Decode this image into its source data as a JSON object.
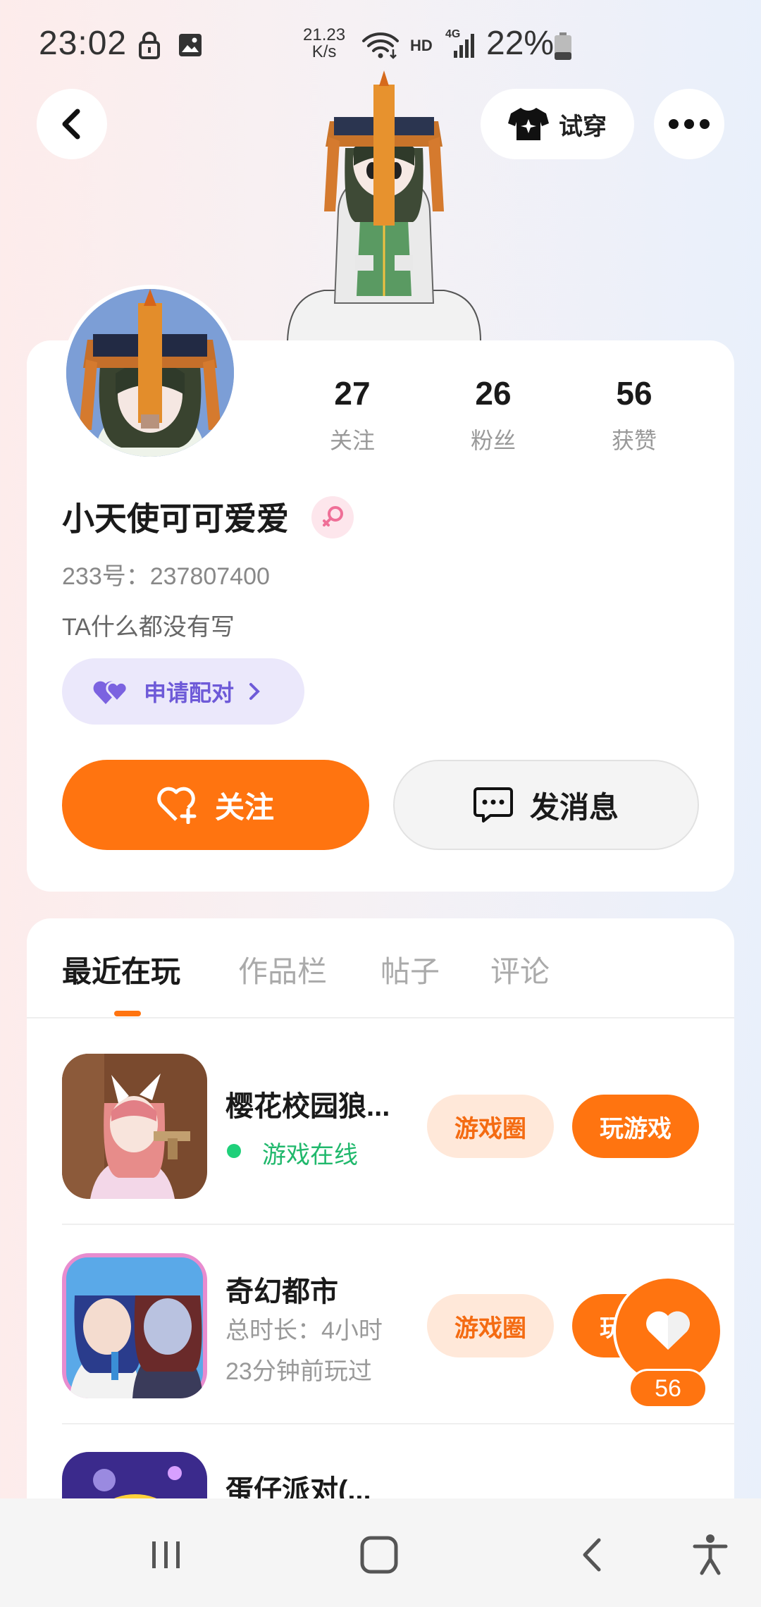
{
  "status_bar": {
    "time": "23:02",
    "net_speed_value": "21.23",
    "net_speed_unit": "K/s",
    "hd": "HD",
    "network": "4G",
    "battery_percent": "22%",
    "icons": [
      "lock-icon",
      "image-icon",
      "wifi-icon",
      "signal-icon",
      "battery-icon"
    ]
  },
  "top_bar": {
    "back_icon": "chevron-left-icon",
    "tryon_label": "试穿",
    "more_icon": "more-dots-icon"
  },
  "profile": {
    "username": "小天使可可爱爱",
    "gender": "female",
    "uid_label": "233号：237807400",
    "bio": "TA什么都没有写",
    "stats": [
      {
        "value": "27",
        "label": "关注"
      },
      {
        "value": "26",
        "label": "粉丝"
      },
      {
        "value": "56",
        "label": "获赞"
      }
    ],
    "pair_label": "申请配对",
    "follow_label": "关注",
    "message_label": "发消息"
  },
  "tabs": [
    {
      "label": "最近在玩",
      "active": true
    },
    {
      "label": "作品栏",
      "active": false
    },
    {
      "label": "帖子",
      "active": false
    },
    {
      "label": "评论",
      "active": false
    }
  ],
  "games": [
    {
      "title": "樱花校园狼...",
      "status": "游戏在线",
      "circle_label": "游戏圈",
      "play_label": "玩游戏"
    },
    {
      "title": "奇幻都市",
      "duration": "总时长：4小时",
      "last_played": "23分钟前玩过",
      "circle_label": "游戏圈",
      "play_label": "玩游戏"
    },
    {
      "title": "蛋仔派对(..."
    }
  ],
  "like_fab": {
    "count": "56"
  },
  "colors": {
    "accent": "#ff7410",
    "pair": "#6e5ad8",
    "online": "#1fd07a"
  }
}
